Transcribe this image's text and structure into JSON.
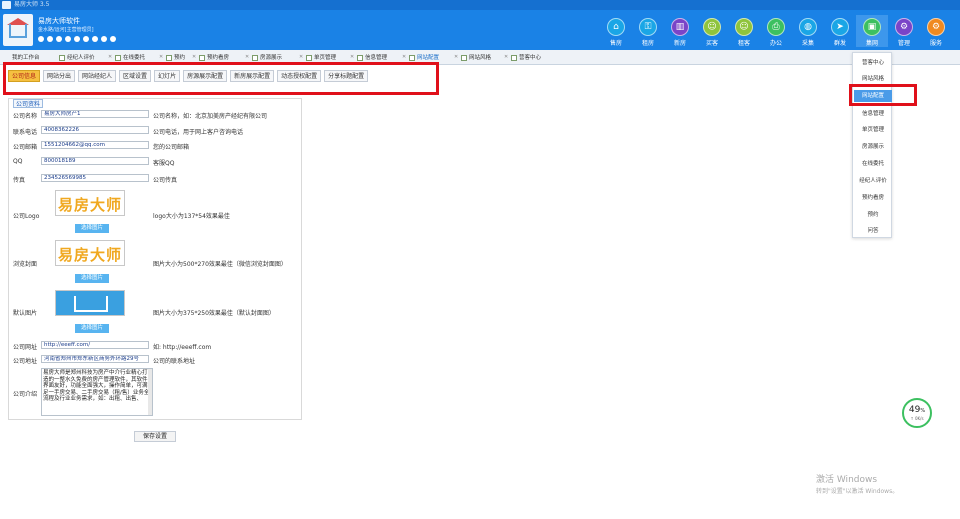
{
  "window": {
    "title": "易房大师 3.5"
  },
  "brand": {
    "name": "易房大师软件",
    "sub": "金水路/运河[主营管理员]"
  },
  "nav": [
    {
      "label": "售房",
      "icon": "home-icon",
      "color": "#1aa6e6"
    },
    {
      "label": "租房",
      "icon": "key-icon",
      "color": "#1aa6e6"
    },
    {
      "label": "新房",
      "icon": "building-icon",
      "color": "#7a44c8"
    },
    {
      "label": "买客",
      "icon": "person-icon",
      "color": "#8fc43c"
    },
    {
      "label": "租客",
      "icon": "person-icon",
      "color": "#8fc43c"
    },
    {
      "label": "办公",
      "icon": "print-icon",
      "color": "#3cc060"
    },
    {
      "label": "采集",
      "icon": "globe-icon",
      "color": "#1aa6e6"
    },
    {
      "label": "群发",
      "icon": "send-icon",
      "color": "#1aa6e6"
    },
    {
      "label": "集网",
      "icon": "net-icon",
      "color": "#3cc060"
    },
    {
      "label": "管理",
      "icon": "gear-icon",
      "color": "#7a44c8"
    },
    {
      "label": "服务",
      "icon": "gear-icon",
      "color": "#f08a20"
    }
  ],
  "tabs": [
    "我的工作台",
    "经纪人评价",
    "在线委托",
    "预约",
    "预约看房",
    "房源展示",
    "单页管理",
    "信息管理",
    "网站配置",
    "网站风格",
    "营客中心"
  ],
  "toolbar": [
    "公司信息",
    "网站分出",
    "网站经纪人",
    "区域设置",
    "幻灯片",
    "房源展示配置",
    "新房展示配置",
    "动态授权配置",
    "分享标题配置"
  ],
  "form": {
    "section": "公司资料",
    "fields": [
      {
        "label": "公司名称",
        "value": "易房大师房产1",
        "hint": "公司名称，如：北京加美房产经纪有限公司"
      },
      {
        "label": "联系电话",
        "value": "4008362226",
        "hint": "公司电话，用于网上客户咨询电话"
      },
      {
        "label": "公司邮箱",
        "value": "1551204662@qq.com",
        "hint": "您的公司邮箱"
      },
      {
        "label": "QQ",
        "value": "800018189",
        "hint": "客服QQ"
      },
      {
        "label": "传真",
        "value": "234526569985",
        "hint": "公司传真"
      }
    ],
    "logo": {
      "label": "公司Logo",
      "text": "易房大师",
      "hint": "logo大小为137*54效果最佳",
      "button": "选择图片"
    },
    "cover": {
      "label": "浏览封面",
      "text": "易房大师",
      "hint": "图片大小为500*270效果最佳（微信浏览封面图）",
      "button": "选择图片"
    },
    "default_img": {
      "label": "默认图片",
      "hint": "图片大小为375*250效果最佳（默认封面图）",
      "button": "选择图片"
    },
    "website": {
      "label": "公司网址",
      "value": "http://eeeff.com/",
      "hint": "如: http://eeeff.com"
    },
    "address": {
      "label": "公司地址",
      "value": "河南省郑州市郑东新区商务外环路29号",
      "hint": "公司的联系地址"
    },
    "intro": {
      "label": "公司介绍",
      "value": "易房大师是郑州科技为房产中介行业精心打造的一整水久免费的房产管理软件，其软件界面友好，功能全面强大，操作简单，可满足一手房交易、二手房交易（租/售）业务全流程及行业业务需求，如：出租、出售、"
    },
    "save": "保存设置"
  },
  "dropdown": [
    "营客中心",
    "网站风格",
    "网站配置",
    "信息管理",
    "单页管理",
    "房源展示",
    "在线委托",
    "经纪人评价",
    "预约看房",
    "预约",
    "问答"
  ],
  "dropdown_active": 2,
  "gauge": {
    "percent": "49",
    "unit": "%",
    "sub": "↑ 0K/s"
  },
  "watermark": {
    "line1": "激活 Windows",
    "line2": "转到\"设置\"以激活 Windows。"
  }
}
